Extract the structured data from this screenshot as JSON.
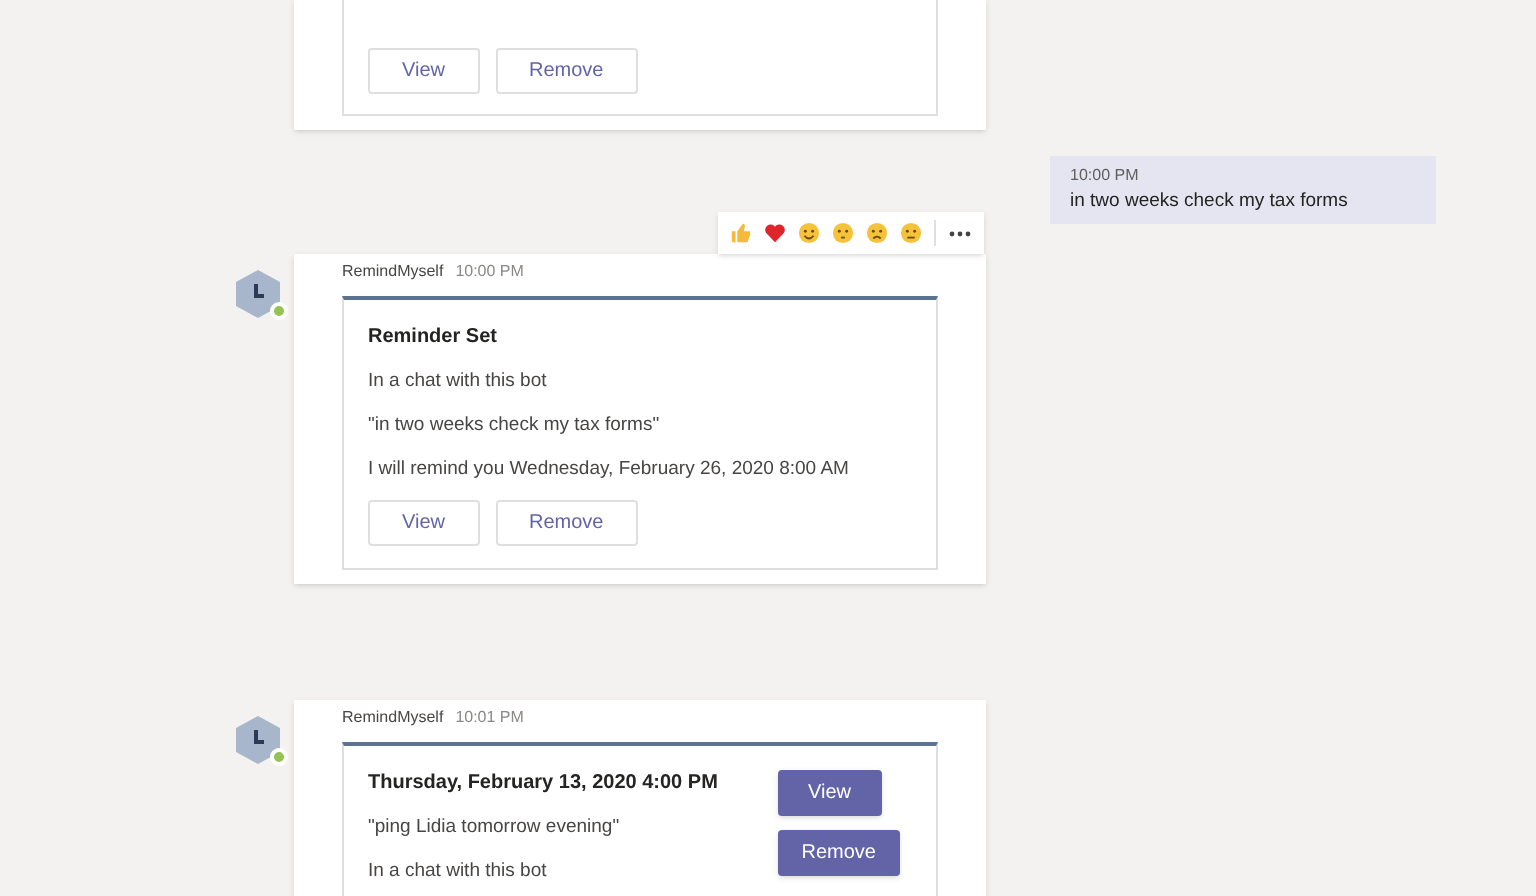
{
  "messages": [
    {
      "kind": "bot_stacked",
      "buttons": [
        {
          "label": "View",
          "primary": false
        },
        {
          "label": "Remove",
          "primary": false
        }
      ]
    },
    {
      "kind": "own",
      "time": "10:00 PM",
      "text": "in two weeks check my tax forms"
    },
    {
      "kind": "bot_stacked",
      "online": true,
      "sender": "RemindMyself",
      "time": "10:00 PM",
      "reactions": true,
      "title": "Reminder Set",
      "lines": [
        "In a chat with this bot",
        "\"in two weeks check my tax forms\"",
        "I will remind you Wednesday, February 26, 2020 8:00 AM"
      ],
      "buttons": [
        {
          "label": "View",
          "primary": false
        },
        {
          "label": "Remove",
          "primary": false
        }
      ]
    },
    {
      "kind": "bot_side",
      "online": true,
      "sender": "RemindMyself",
      "time": "10:01 PM",
      "title": "Thursday, February 13, 2020 4:00 PM",
      "lines": [
        "\"ping Lidia tomorrow evening\"",
        "In a chat with this bot"
      ],
      "buttons": [
        {
          "label": "View",
          "primary": true
        },
        {
          "label": "Remove",
          "primary": true
        }
      ]
    }
  ]
}
